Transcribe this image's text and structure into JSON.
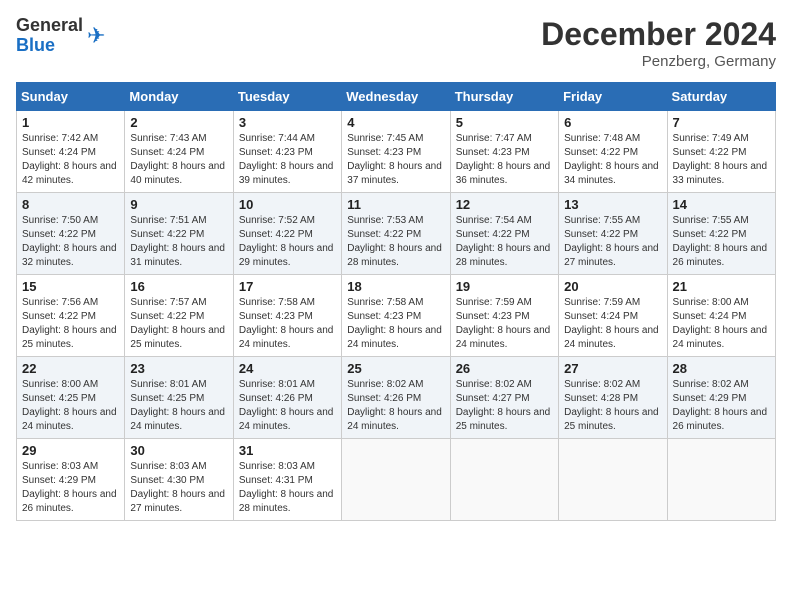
{
  "header": {
    "logo_general": "General",
    "logo_blue": "Blue",
    "month_title": "December 2024",
    "location": "Penzberg, Germany"
  },
  "weekdays": [
    "Sunday",
    "Monday",
    "Tuesday",
    "Wednesday",
    "Thursday",
    "Friday",
    "Saturday"
  ],
  "weeks": [
    [
      {
        "day": "1",
        "sunrise": "7:42 AM",
        "sunset": "4:24 PM",
        "daylight": "8 hours and 42 minutes."
      },
      {
        "day": "2",
        "sunrise": "7:43 AM",
        "sunset": "4:24 PM",
        "daylight": "8 hours and 40 minutes."
      },
      {
        "day": "3",
        "sunrise": "7:44 AM",
        "sunset": "4:23 PM",
        "daylight": "8 hours and 39 minutes."
      },
      {
        "day": "4",
        "sunrise": "7:45 AM",
        "sunset": "4:23 PM",
        "daylight": "8 hours and 37 minutes."
      },
      {
        "day": "5",
        "sunrise": "7:47 AM",
        "sunset": "4:23 PM",
        "daylight": "8 hours and 36 minutes."
      },
      {
        "day": "6",
        "sunrise": "7:48 AM",
        "sunset": "4:22 PM",
        "daylight": "8 hours and 34 minutes."
      },
      {
        "day": "7",
        "sunrise": "7:49 AM",
        "sunset": "4:22 PM",
        "daylight": "8 hours and 33 minutes."
      }
    ],
    [
      {
        "day": "8",
        "sunrise": "7:50 AM",
        "sunset": "4:22 PM",
        "daylight": "8 hours and 32 minutes."
      },
      {
        "day": "9",
        "sunrise": "7:51 AM",
        "sunset": "4:22 PM",
        "daylight": "8 hours and 31 minutes."
      },
      {
        "day": "10",
        "sunrise": "7:52 AM",
        "sunset": "4:22 PM",
        "daylight": "8 hours and 29 minutes."
      },
      {
        "day": "11",
        "sunrise": "7:53 AM",
        "sunset": "4:22 PM",
        "daylight": "8 hours and 28 minutes."
      },
      {
        "day": "12",
        "sunrise": "7:54 AM",
        "sunset": "4:22 PM",
        "daylight": "8 hours and 28 minutes."
      },
      {
        "day": "13",
        "sunrise": "7:55 AM",
        "sunset": "4:22 PM",
        "daylight": "8 hours and 27 minutes."
      },
      {
        "day": "14",
        "sunrise": "7:55 AM",
        "sunset": "4:22 PM",
        "daylight": "8 hours and 26 minutes."
      }
    ],
    [
      {
        "day": "15",
        "sunrise": "7:56 AM",
        "sunset": "4:22 PM",
        "daylight": "8 hours and 25 minutes."
      },
      {
        "day": "16",
        "sunrise": "7:57 AM",
        "sunset": "4:22 PM",
        "daylight": "8 hours and 25 minutes."
      },
      {
        "day": "17",
        "sunrise": "7:58 AM",
        "sunset": "4:23 PM",
        "daylight": "8 hours and 24 minutes."
      },
      {
        "day": "18",
        "sunrise": "7:58 AM",
        "sunset": "4:23 PM",
        "daylight": "8 hours and 24 minutes."
      },
      {
        "day": "19",
        "sunrise": "7:59 AM",
        "sunset": "4:23 PM",
        "daylight": "8 hours and 24 minutes."
      },
      {
        "day": "20",
        "sunrise": "7:59 AM",
        "sunset": "4:24 PM",
        "daylight": "8 hours and 24 minutes."
      },
      {
        "day": "21",
        "sunrise": "8:00 AM",
        "sunset": "4:24 PM",
        "daylight": "8 hours and 24 minutes."
      }
    ],
    [
      {
        "day": "22",
        "sunrise": "8:00 AM",
        "sunset": "4:25 PM",
        "daylight": "8 hours and 24 minutes."
      },
      {
        "day": "23",
        "sunrise": "8:01 AM",
        "sunset": "4:25 PM",
        "daylight": "8 hours and 24 minutes."
      },
      {
        "day": "24",
        "sunrise": "8:01 AM",
        "sunset": "4:26 PM",
        "daylight": "8 hours and 24 minutes."
      },
      {
        "day": "25",
        "sunrise": "8:02 AM",
        "sunset": "4:26 PM",
        "daylight": "8 hours and 24 minutes."
      },
      {
        "day": "26",
        "sunrise": "8:02 AM",
        "sunset": "4:27 PM",
        "daylight": "8 hours and 25 minutes."
      },
      {
        "day": "27",
        "sunrise": "8:02 AM",
        "sunset": "4:28 PM",
        "daylight": "8 hours and 25 minutes."
      },
      {
        "day": "28",
        "sunrise": "8:02 AM",
        "sunset": "4:29 PM",
        "daylight": "8 hours and 26 minutes."
      }
    ],
    [
      {
        "day": "29",
        "sunrise": "8:03 AM",
        "sunset": "4:29 PM",
        "daylight": "8 hours and 26 minutes."
      },
      {
        "day": "30",
        "sunrise": "8:03 AM",
        "sunset": "4:30 PM",
        "daylight": "8 hours and 27 minutes."
      },
      {
        "day": "31",
        "sunrise": "8:03 AM",
        "sunset": "4:31 PM",
        "daylight": "8 hours and 28 minutes."
      },
      null,
      null,
      null,
      null
    ]
  ]
}
